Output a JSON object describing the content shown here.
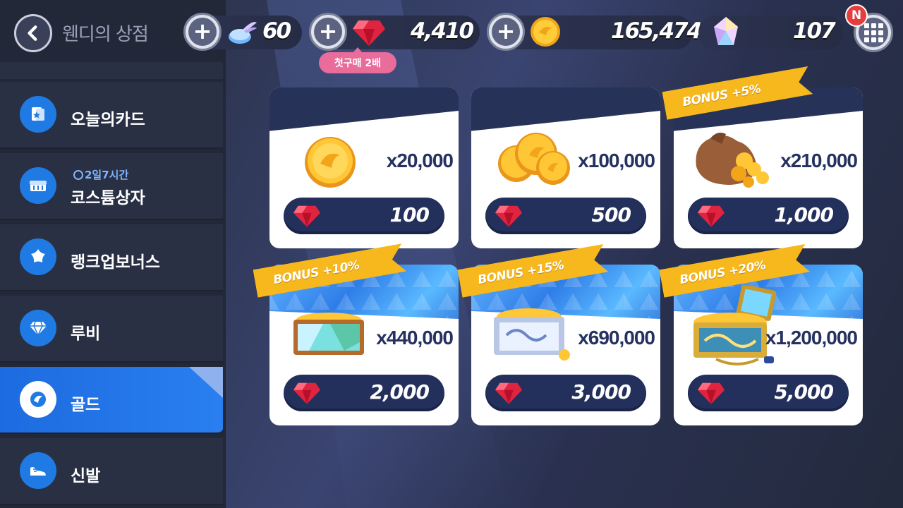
{
  "header": {
    "title": "웬디의 상점",
    "first_purchase_badge": "첫구매 2배",
    "new_badge": "N"
  },
  "currencies": {
    "tickets": "60",
    "ruby": "4,410",
    "gold": "165,474",
    "crystal": "107"
  },
  "sidebar": {
    "items": [
      {
        "label": "오늘의카드",
        "icon": "card-star-icon"
      },
      {
        "label": "코스튬상자",
        "icon": "costume-box-icon",
        "sub": "2일7시간"
      },
      {
        "label": "랭크업보너스",
        "icon": "star-icon"
      },
      {
        "label": "루비",
        "icon": "diamond-icon"
      },
      {
        "label": "골드",
        "icon": "wing-coin-icon",
        "active": true
      },
      {
        "label": "신발",
        "icon": "shoe-icon"
      }
    ]
  },
  "products": [
    {
      "amount": "x20,000",
      "price": "100",
      "bonus": ""
    },
    {
      "amount": "x100,000",
      "price": "500",
      "bonus": ""
    },
    {
      "amount": "x210,000",
      "price": "1,000",
      "bonus": "BONUS +5%"
    },
    {
      "amount": "x440,000",
      "price": "2,000",
      "bonus": "BONUS +10%"
    },
    {
      "amount": "x690,000",
      "price": "3,000",
      "bonus": "BONUS +15%"
    },
    {
      "amount": "x1,200,000",
      "price": "5,000",
      "bonus": "BONUS +20%"
    }
  ],
  "colors": {
    "accent": "#1f7be3",
    "price_button": "#24305c",
    "ribbon": "#f7b81e",
    "new_badge": "#e53d3d",
    "first_badge": "#e96c9a"
  }
}
